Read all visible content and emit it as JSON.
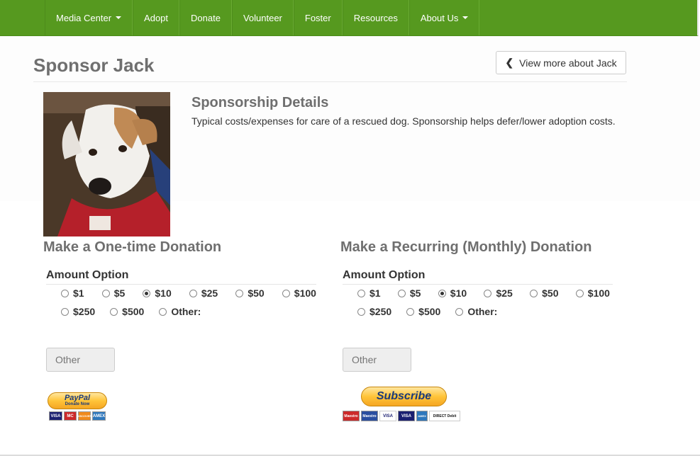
{
  "nav": {
    "items": [
      {
        "label": "Media Center",
        "dropdown": true
      },
      {
        "label": "Adopt",
        "dropdown": false
      },
      {
        "label": "Donate",
        "dropdown": false
      },
      {
        "label": "Volunteer",
        "dropdown": false
      },
      {
        "label": "Foster",
        "dropdown": false
      },
      {
        "label": "Resources",
        "dropdown": false
      },
      {
        "label": "About Us",
        "dropdown": true
      }
    ],
    "bg_color": "#56991f"
  },
  "page": {
    "title": "Sponsor Jack",
    "view_more_label": "View more about Jack",
    "photo_icon": "dog-photo"
  },
  "details": {
    "heading": "Sponsorship Details",
    "text": "Typical costs/expenses for care of a rescued dog. Sponsorship helps defer/lower adoption costs."
  },
  "one_time": {
    "heading": "Make a One-time Donation",
    "amount_label": "Amount Option",
    "options_row1": [
      "$1",
      "$5",
      "$10",
      "$25",
      "$50",
      "$100"
    ],
    "options_row2": [
      "$250",
      "$500",
      "Other:"
    ],
    "selected": "$10",
    "other_placeholder": "Other",
    "button_text_top": "PayPal",
    "button_text_bottom": "Donate Now",
    "cards": [
      "VISA",
      "MC",
      "DISCOVER",
      "AMEX"
    ]
  },
  "recurring": {
    "heading": "Make a Recurring (Monthly) Donation",
    "amount_label": "Amount Option",
    "options_row1": [
      "$1",
      "$5",
      "$10",
      "$25",
      "$50",
      "$100"
    ],
    "options_row2": [
      "$250",
      "$500",
      "Other:"
    ],
    "selected": "$10",
    "other_placeholder": "Other",
    "button_text": "Subscribe",
    "cards": [
      "Maestro",
      "Maestro",
      "VISA",
      "VISA",
      "AMEX",
      "DIRECT Debit"
    ]
  }
}
